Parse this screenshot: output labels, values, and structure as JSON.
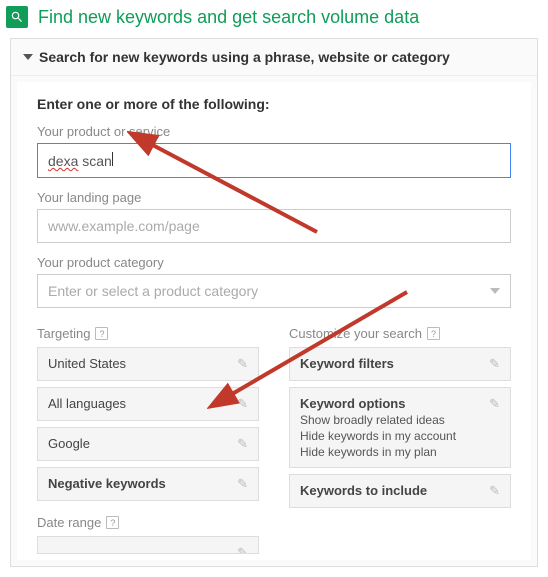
{
  "header": {
    "title": "Find new keywords and get search volume data"
  },
  "panel": {
    "heading": "Search for new keywords using a phrase, website or category"
  },
  "form": {
    "intro": "Enter one or more of the following:",
    "product_label": "Your product or service",
    "product_value_misspelled": "dexa",
    "product_value_rest": " scan",
    "landing_label": "Your landing page",
    "landing_placeholder": "www.example.com/page",
    "category_label": "Your product category",
    "category_placeholder": "Enter or select a product category"
  },
  "targeting": {
    "label": "Targeting",
    "items": [
      {
        "label": "United States"
      },
      {
        "label": "All languages"
      },
      {
        "label": "Google"
      },
      {
        "label": "Negative keywords",
        "bold": true
      }
    ]
  },
  "date_range": {
    "label": "Date range"
  },
  "customize": {
    "label": "Customize your search",
    "filters": {
      "title": "Keyword filters"
    },
    "options": {
      "title": "Keyword options",
      "lines": [
        "Show broadly related ideas",
        "Hide keywords in my account",
        "Hide keywords in my plan"
      ]
    },
    "include": {
      "title": "Keywords to include"
    }
  }
}
